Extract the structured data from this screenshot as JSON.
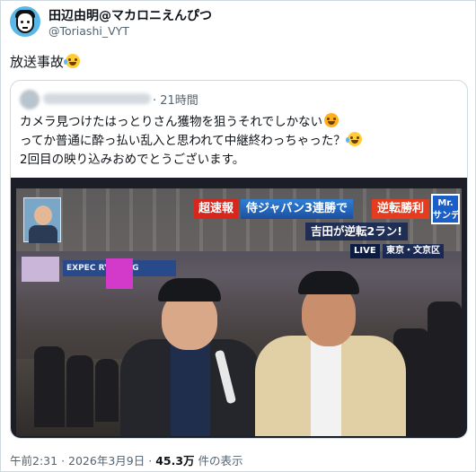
{
  "author": {
    "display_name": "田辺由明@マカロニえんぴつ",
    "handle": "@Toriashi_VYT",
    "avatar_icon": "cartoon-avatar-icon"
  },
  "tweet": {
    "text": "放送事故",
    "emoji_icon": "face-with-tears-of-joy-icon"
  },
  "quoted": {
    "time": "21時間",
    "lines": [
      "カメラ見つけたはっとりさん獲物を狙うそれでしかない",
      "ってか普通に酔っ払い乱入と思われて中継終わっちゃった？",
      "2回目の映り込みおめでとうございます。"
    ]
  },
  "video": {
    "banner_tag": "超速報",
    "banner_main": "侍ジャパン3連勝で",
    "banner_result": "逆転勝利",
    "sub_caption": "吉田が逆転2ラン!",
    "live": "LIVE",
    "location": "東京・文京区",
    "logo": "Mr.\nサンデ",
    "ad_text": "EXPEC    RYTHING"
  },
  "footer": {
    "time": "午前2:31",
    "date": "2026年3月9日",
    "views": "45.3万",
    "views_suffix": "件の表示",
    "separator": "·"
  },
  "colors": {
    "text": "#0f1419",
    "muted": "#536471",
    "border": "#cfd9de",
    "breaking_red": "#d8261d"
  }
}
